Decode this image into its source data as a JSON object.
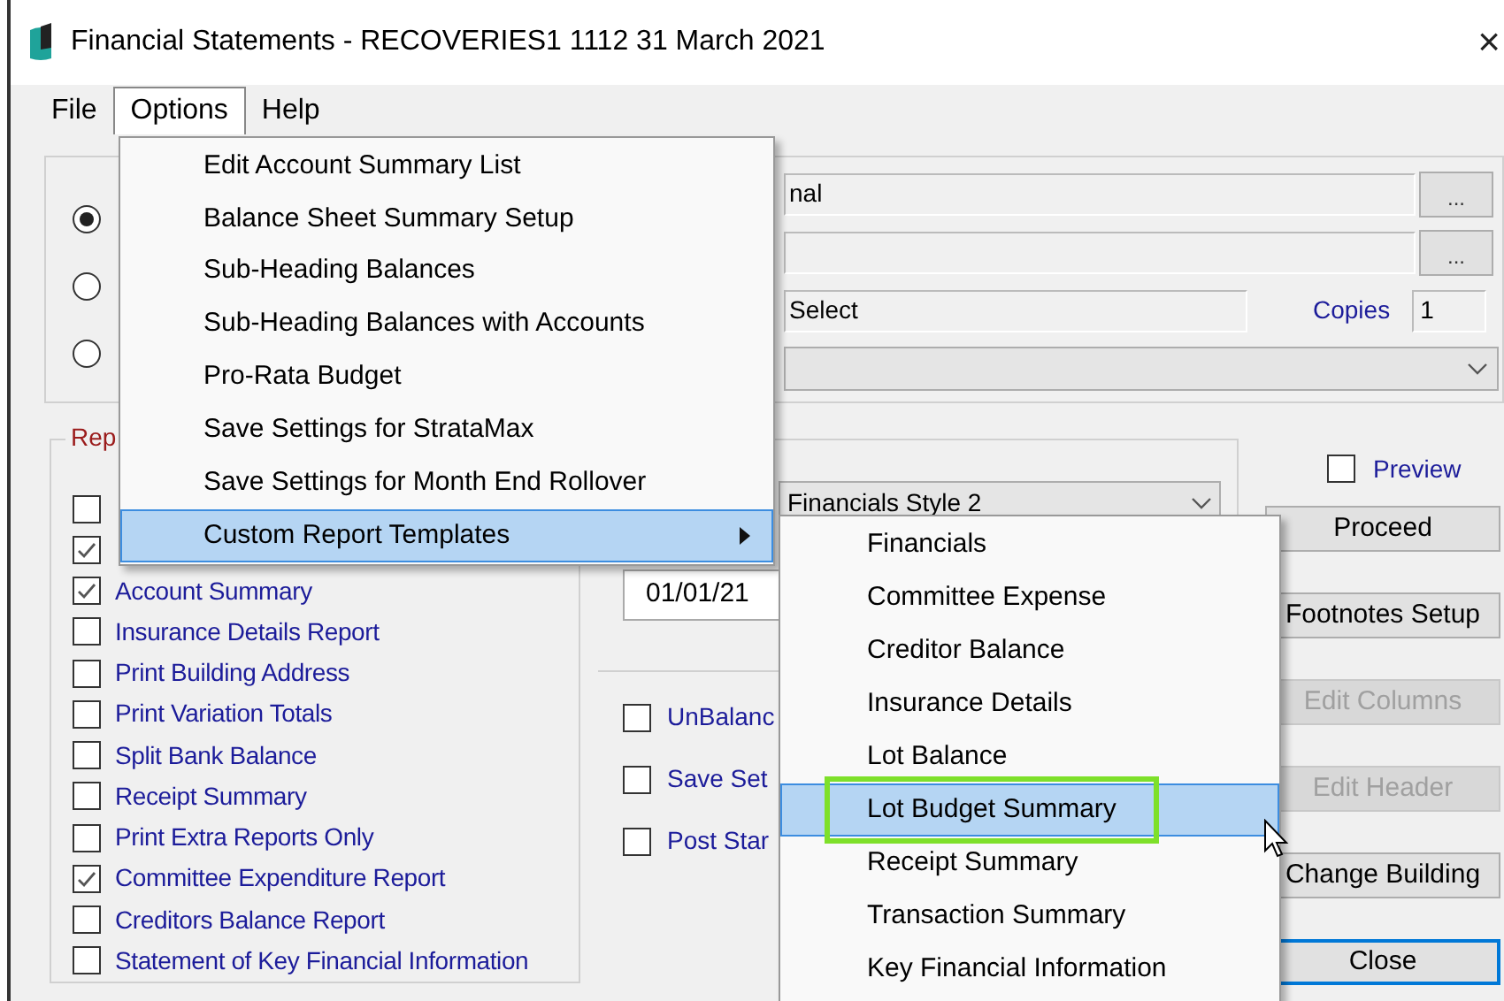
{
  "window": {
    "title": "Financial Statements - RECOVERIES1 1112 31 March 2021",
    "close": "×"
  },
  "menu_bar": [
    {
      "label": "File",
      "selected": false
    },
    {
      "label": "Options",
      "selected": true
    },
    {
      "label": "Help",
      "selected": false
    }
  ],
  "options_menu": [
    {
      "label": "Edit Account Summary List",
      "kind": "command",
      "selected": false
    },
    {
      "label": "Balance Sheet Summary Setup",
      "kind": "command",
      "selected": false
    },
    {
      "label": "Sub-Heading Balances",
      "kind": "command",
      "selected": false
    },
    {
      "label": "Sub-Heading Balances with Accounts",
      "kind": "command",
      "selected": false
    },
    {
      "label": "Pro-Rata Budget",
      "kind": "command",
      "selected": false
    },
    {
      "label": "Save Settings for StrataMax",
      "kind": "command",
      "selected": false
    },
    {
      "label": "Save Settings for Month End Rollover",
      "kind": "command",
      "selected": false
    },
    {
      "label": "Custom Report Templates",
      "kind": "submenu",
      "selected": true
    }
  ],
  "templates_submenu": [
    {
      "label": "Financials",
      "selected": false
    },
    {
      "label": "Committee Expense",
      "selected": false
    },
    {
      "label": "Creditor Balance",
      "selected": false
    },
    {
      "label": "Insurance Details",
      "selected": false
    },
    {
      "label": "Lot Balance",
      "selected": false
    },
    {
      "label": "Lot Budget Summary",
      "selected": true,
      "highlighted": true
    },
    {
      "label": "Receipt Summary",
      "selected": false
    },
    {
      "label": "Transaction Summary",
      "selected": false
    },
    {
      "label": "Key Financial Information",
      "selected": false
    }
  ],
  "radios": [
    {
      "selected": true
    },
    {
      "selected": false
    },
    {
      "selected": false
    }
  ],
  "fields": [
    {
      "value": "nal",
      "button": "..."
    },
    {
      "button": "..."
    }
  ],
  "select_field": {
    "value": "Select"
  },
  "copies": {
    "label": "Copies",
    "value": "1"
  },
  "report_group": {
    "legend": "Rep",
    "items": [
      {
        "checked": false
      },
      {
        "checked": true
      },
      {
        "label": "Account Summary",
        "checked": true
      },
      {
        "label": "Insurance Details Report",
        "checked": false
      },
      {
        "label": "Print Building Address",
        "checked": false
      },
      {
        "label": "Print Variation Totals",
        "checked": false
      },
      {
        "label": "Split Bank Balance",
        "checked": false
      },
      {
        "label": "Receipt Summary",
        "checked": false
      },
      {
        "label": "Print Extra Reports Only",
        "checked": false
      },
      {
        "label": "Committee Expenditure Report",
        "checked": true
      },
      {
        "label": "Creditors Balance Report",
        "checked": false
      },
      {
        "label": "Statement of Key Financial Information",
        "checked": false
      }
    ]
  },
  "style_dropdown": {
    "value": "Financials Style 2"
  },
  "date_field": {
    "value": "01/01/21"
  },
  "options": [
    {
      "label": "UnBalanc",
      "checked": false
    },
    {
      "label": "Save Set",
      "checked": false
    },
    {
      "label": "Post Star",
      "checked": false
    }
  ],
  "preview": {
    "label": "Preview",
    "checked": false
  },
  "buttons": [
    {
      "label": "Proceed",
      "disabled": false,
      "default": false
    },
    {
      "label": "Footnotes Setup",
      "disabled": false,
      "default": false
    },
    {
      "label": "Edit Columns",
      "disabled": true,
      "default": false
    },
    {
      "label": "Edit Header",
      "disabled": true,
      "default": false
    },
    {
      "label": "Change Building",
      "disabled": false,
      "default": false
    },
    {
      "label": "Close",
      "disabled": false,
      "default": true
    }
  ]
}
